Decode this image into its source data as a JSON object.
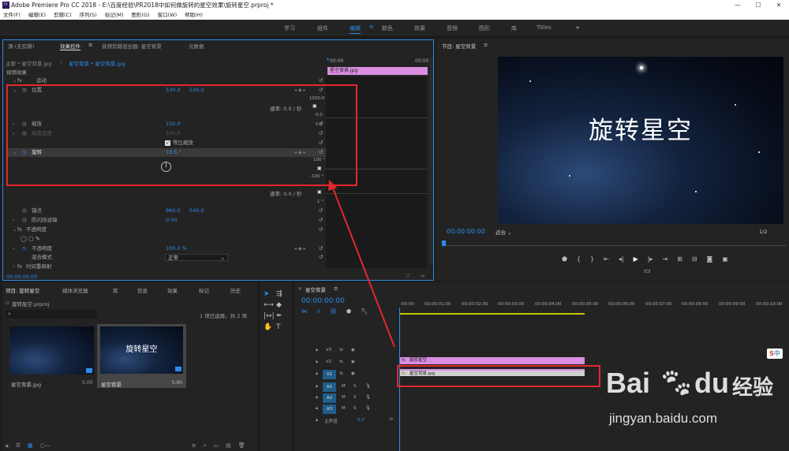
{
  "titlebar": {
    "logo": "Pr",
    "title": "Adobe Premiere Pro CC 2018 - E:\\百度经验\\PR2018中如何做旋转的星空效果\\旋转星空.prproj *",
    "minimize": "—",
    "maximize": "☐",
    "close": "✕"
  },
  "menu": [
    "文件(F)",
    "编辑(E)",
    "剪辑(C)",
    "序列(S)",
    "标记(M)",
    "图形(G)",
    "窗口(W)",
    "帮助(H)"
  ],
  "workspaces": [
    "学习",
    "组件",
    "编辑",
    "颜色",
    "效果",
    "音频",
    "图形",
    "库",
    "Titles"
  ],
  "workspace_more": "»",
  "effect_controls": {
    "tabs": [
      "源:(无剪辑)",
      "效果控件",
      "音频剪辑混合器: 星空背景",
      "元数据"
    ],
    "menu_icon": "≡",
    "breadcrumb_master": "主要 * 星空背景.jpg",
    "breadcrumb_seq": "星空背景 * 星空背景.jpg",
    "mini_timecode_start": "00:00",
    "mini_timecode_end": "00:00",
    "clip_label": "星空背景.jpg",
    "section_video": "视频效果",
    "motion": "运动",
    "position_label": "位置",
    "position_x": "530.0",
    "position_y": "534.0",
    "pos_max": "1920.0",
    "pos_zero": "0.0",
    "pos_zero2": "0.0",
    "velocity": "速率: 0.0 / 秒",
    "scale_label": "缩放",
    "scale_value": "150.0",
    "scale_width_label": "缩放宽度",
    "scale_width_value": "100.0",
    "uniform_scale": "等比缩放",
    "rotation_label": "旋转",
    "rotation_value": "10.5 °",
    "rot_max": "100 °",
    "rot_min": "-100 °",
    "velocity2": "速率: 0.0 / 秒",
    "vel_min": "-1 °",
    "anchor_label": "锚点",
    "anchor_x": "960.0",
    "anchor_y": "540.0",
    "antiflicker_label": "防闪烁滤镜",
    "antiflicker_value": "0.00",
    "opacity_section": "不透明度",
    "opacity_label": "不透明度",
    "opacity_value": "100.0 %",
    "blend_label": "混合模式",
    "blend_value": "正常",
    "time_remap": "时间重映射",
    "fx": "fx",
    "timecode": "00:00:00:00"
  },
  "program": {
    "title": "节目: 星空背景",
    "menu_icon": "≡",
    "overlay_text": "旋转星空",
    "timecode": "00:00:00:00",
    "fit": "适合",
    "fraction": "1/2"
  },
  "project": {
    "tabs": [
      "项目: 旋转星空",
      "媒体浏览器",
      "库",
      "信息",
      "效果",
      "标记",
      "历史"
    ],
    "file": "旋转星空.prproj",
    "selection": "1 项已选择，共 2 项",
    "items": [
      {
        "name": "星空背景.jpg",
        "duration": "5:00"
      },
      {
        "name": "星空背景",
        "duration": "5:00",
        "thumb_text": "旋转星空"
      }
    ]
  },
  "timeline": {
    "title": "星空背景",
    "menu_icon": "≡",
    "timecode": "00:00:00:00",
    "ruler": [
      ":00:00",
      "00:00:01:00",
      "00:00:02:00",
      "00:00:03:00",
      "00:00:04:00",
      "00:00:05:00",
      "00:00:06:00",
      "00:00:07:00",
      "00:00:08:00",
      "00:00:09:00",
      "00:00:10:00"
    ],
    "tracks": [
      {
        "id": "V3"
      },
      {
        "id": "V2"
      },
      {
        "id": "V1"
      },
      {
        "id": "A1"
      },
      {
        "id": "A2"
      },
      {
        "id": "A3"
      }
    ],
    "master": "主声道",
    "master_value": "0.0",
    "clips": [
      {
        "name": "旋转星空",
        "track": "V2",
        "color": "#d98ee0"
      },
      {
        "name": "星空背景.jpg",
        "track": "V1",
        "color": "#d98ee0"
      }
    ]
  },
  "watermark": {
    "brand": "Bai",
    "paw": "du",
    "cn": "经验",
    "url": "jingyan.baidu.com"
  },
  "ime": "中"
}
